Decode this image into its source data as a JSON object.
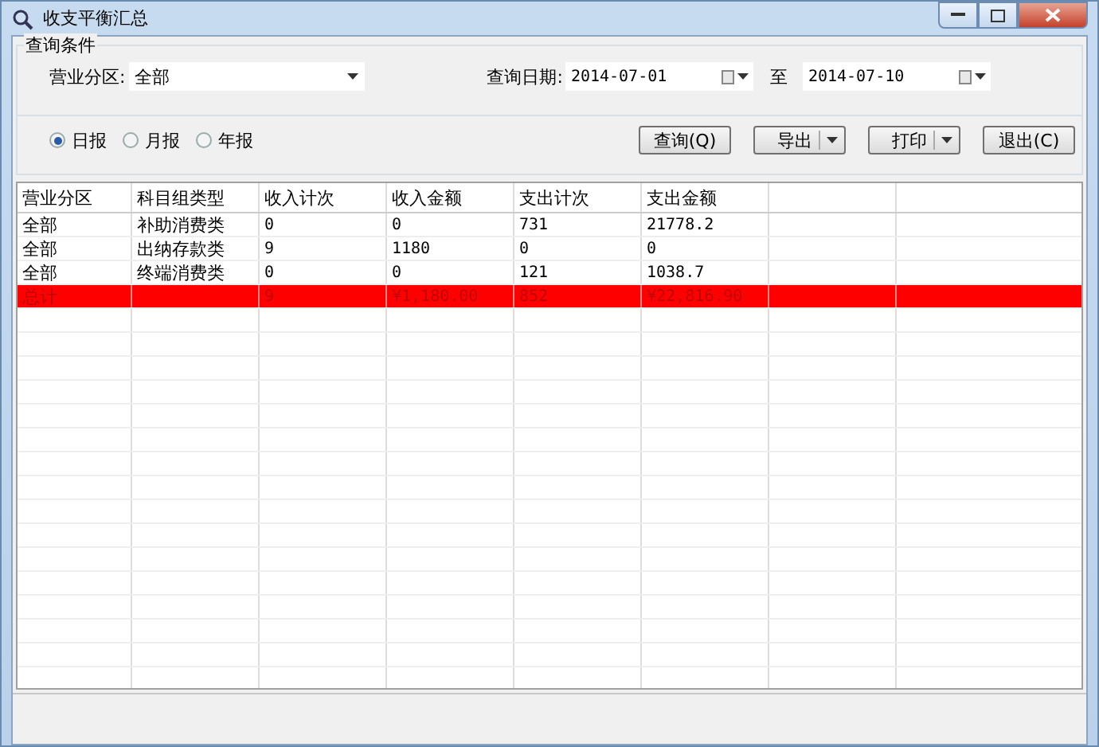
{
  "window": {
    "title": "收支平衡汇总"
  },
  "query": {
    "group_title": "查询条件",
    "zone_label": "营业分区:",
    "zone_value": "全部",
    "date_label": "查询日期:",
    "date_from": "2014-07-01",
    "date_to_label": "至",
    "date_to": "2014-07-10"
  },
  "report_types": [
    {
      "label": "日报",
      "selected": true
    },
    {
      "label": "月报",
      "selected": false
    },
    {
      "label": "年报",
      "selected": false
    }
  ],
  "buttons": [
    {
      "label": "查询(Q)",
      "kind": "plain"
    },
    {
      "label": "导出",
      "kind": "split"
    },
    {
      "label": "打印",
      "kind": "split"
    },
    {
      "label": "退出(C)",
      "kind": "plain"
    }
  ],
  "table": {
    "columns": [
      "营业分区",
      "科目组类型",
      "收入计次",
      "收入金额",
      "支出计次",
      "支出金额"
    ],
    "rows": [
      {
        "kind": "data",
        "cells": [
          "全部",
          "补助消费类",
          "0",
          "0",
          "731",
          "21778.2"
        ]
      },
      {
        "kind": "data",
        "cells": [
          "全部",
          "出纳存款类",
          "9",
          "1180",
          "0",
          "0"
        ]
      },
      {
        "kind": "data",
        "cells": [
          "全部",
          "终端消费类",
          "0",
          "0",
          "121",
          "1038.7"
        ]
      },
      {
        "kind": "total",
        "cells": [
          "总计",
          "",
          "9",
          "¥1,180.00",
          "852",
          "¥22,816.90"
        ]
      }
    ]
  }
}
